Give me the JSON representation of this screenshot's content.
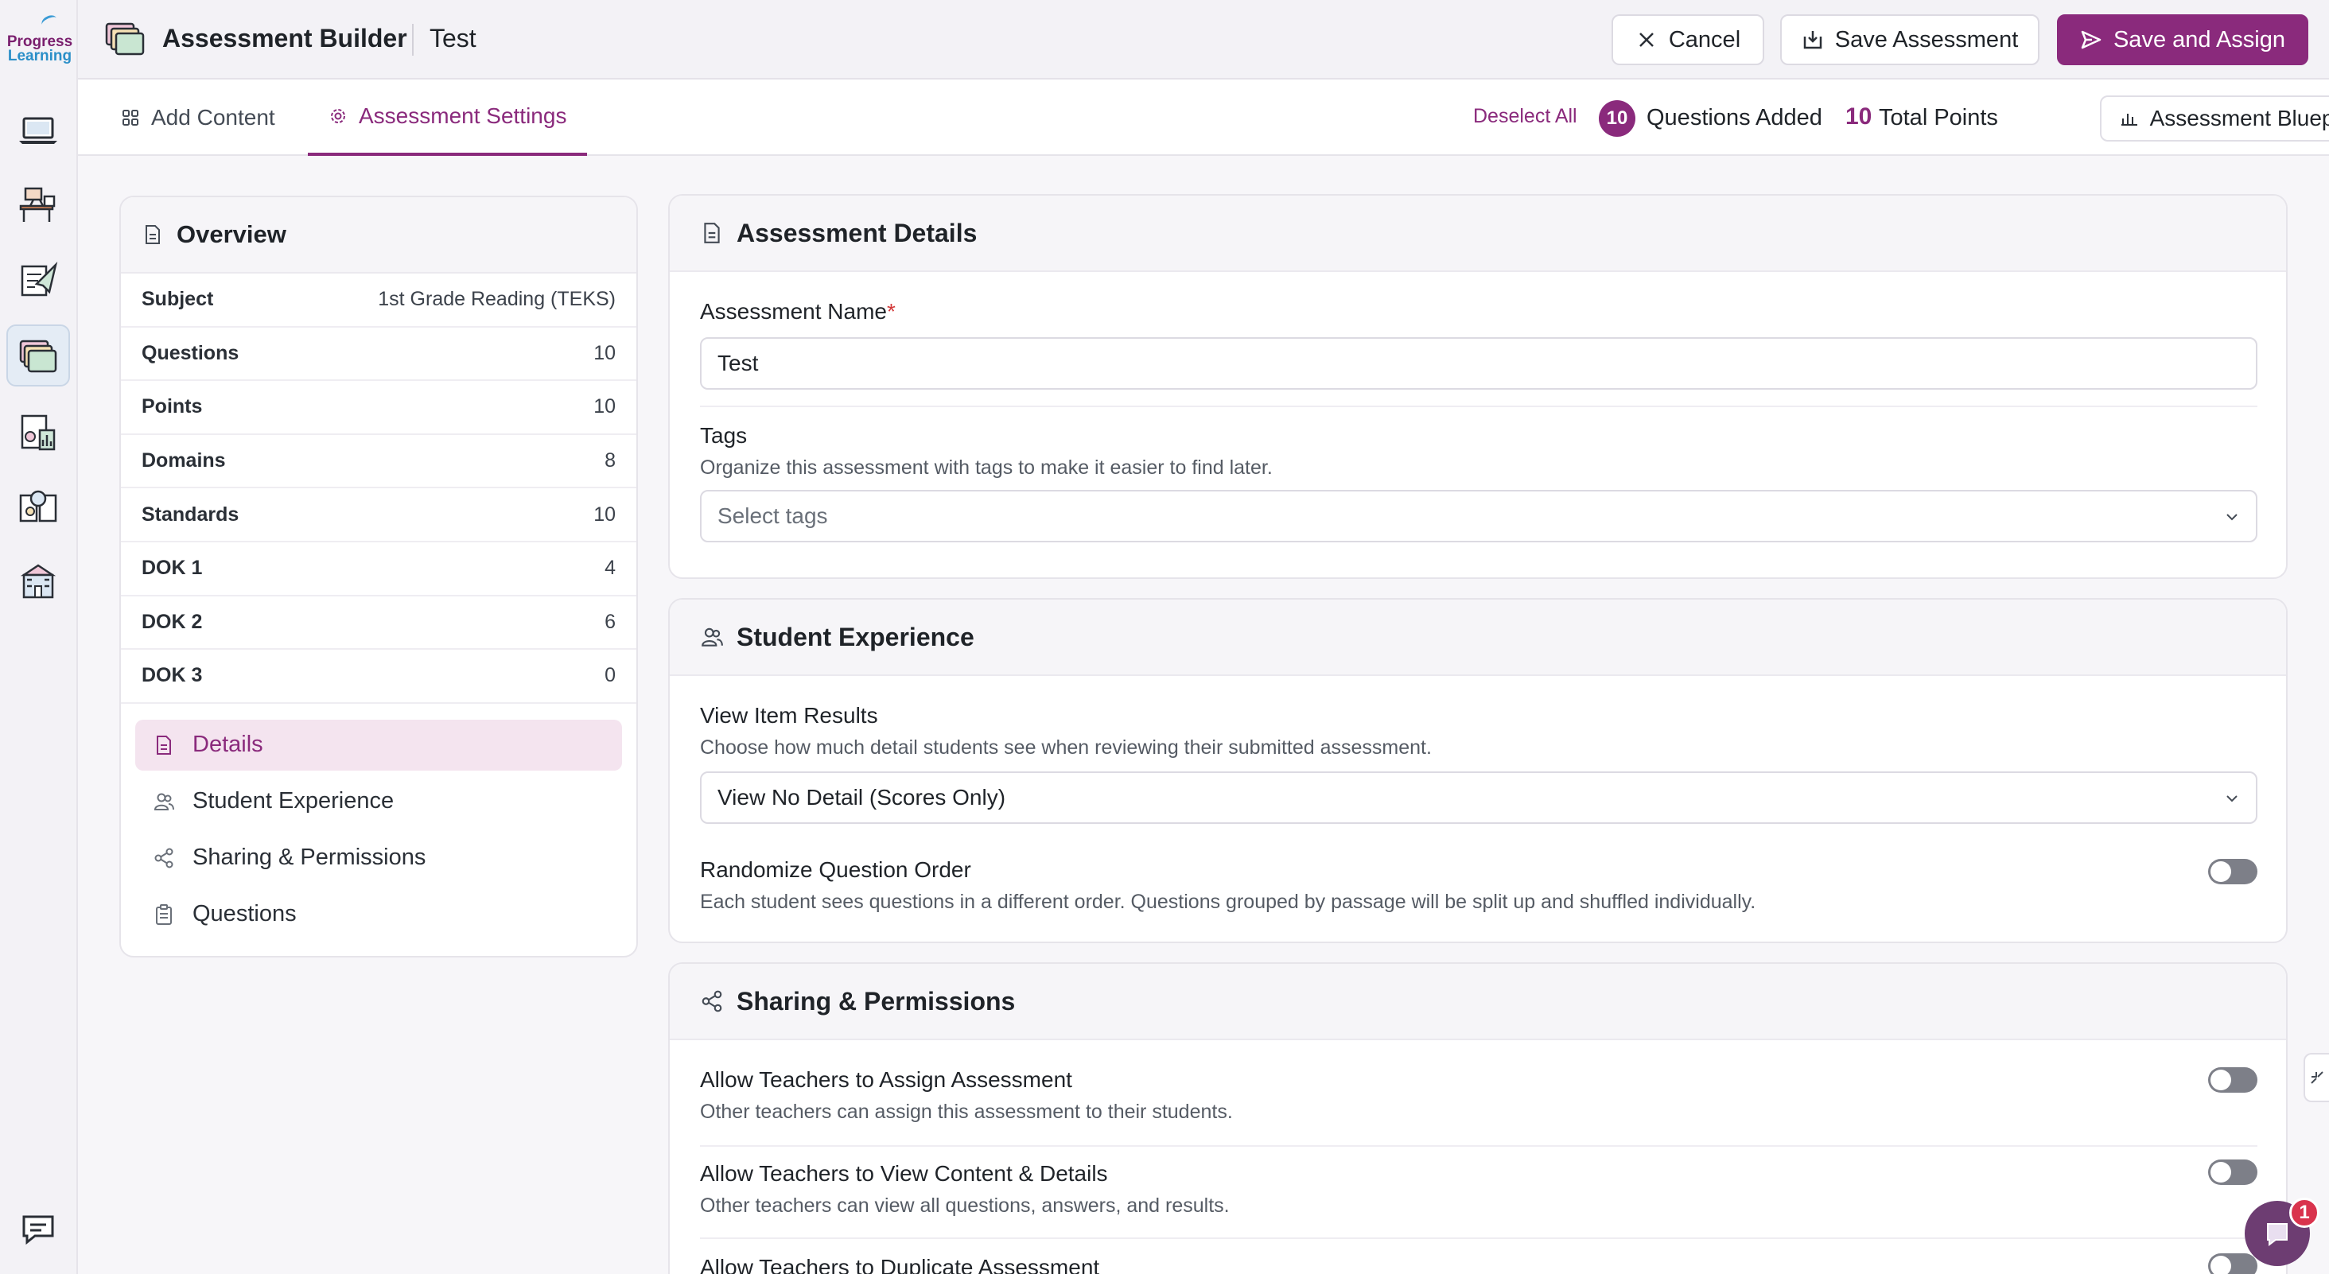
{
  "logo": {
    "line1": "Progress",
    "line2": "Learning"
  },
  "header": {
    "app_title": "Assessment Builder",
    "doc_title": "Test",
    "cancel_label": "Cancel",
    "save_label": "Save Assessment",
    "save_assign_label": "Save and Assign"
  },
  "tabs": [
    {
      "label": "Add Content",
      "icon": "grid-icon"
    },
    {
      "label": "Assessment Settings",
      "icon": "gear-icon",
      "active": true
    }
  ],
  "toolbar": {
    "deselect_label": "Deselect All",
    "questions_count": "10",
    "questions_label": "Questions Added",
    "points_count": "10",
    "points_label": "Total Points",
    "blueprint_label": "Assessment Blueprint"
  },
  "overview": {
    "title": "Overview",
    "rows": [
      {
        "key": "Subject",
        "value": "1st Grade Reading (TEKS)"
      },
      {
        "key": "Questions",
        "value": "10"
      },
      {
        "key": "Points",
        "value": "10"
      },
      {
        "key": "Domains",
        "value": "8"
      },
      {
        "key": "Standards",
        "value": "10"
      },
      {
        "key": "DOK 1",
        "value": "4"
      },
      {
        "key": "DOK 2",
        "value": "6"
      },
      {
        "key": "DOK 3",
        "value": "0"
      }
    ],
    "nav": [
      {
        "label": "Details",
        "icon": "document-icon",
        "active": true
      },
      {
        "label": "Student Experience",
        "icon": "users-icon"
      },
      {
        "label": "Sharing & Permissions",
        "icon": "share-icon"
      },
      {
        "label": "Questions",
        "icon": "clipboard-icon"
      }
    ]
  },
  "details": {
    "title": "Assessment Details",
    "name_label": "Assessment Name",
    "name_required": "*",
    "name_value": "Test",
    "tags_label": "Tags",
    "tags_help": "Organize this assessment with tags to make it easier to find later.",
    "tags_placeholder": "Select tags"
  },
  "student_experience": {
    "title": "Student Experience",
    "view_label": "View Item Results",
    "view_help": "Choose how much detail students see when reviewing their submitted assessment.",
    "view_value": "View No Detail (Scores Only)",
    "randomize_label": "Randomize Question Order",
    "randomize_help": "Each student sees questions in a different order. Questions grouped by passage will be split up and shuffled individually.",
    "randomize_on": false
  },
  "sharing": {
    "title": "Sharing & Permissions",
    "items": [
      {
        "label": "Allow Teachers to Assign Assessment",
        "help": "Other teachers can assign this assessment to their students.",
        "on": false
      },
      {
        "label": "Allow Teachers to View Content & Details",
        "help": "Other teachers can view all questions, answers, and results.",
        "on": false
      },
      {
        "label": "Allow Teachers to Duplicate Assessment",
        "help": "",
        "on": false
      }
    ]
  },
  "chat": {
    "badge": "1"
  },
  "colors": {
    "brand": "#8a2a7c",
    "badge": "#d9334d",
    "toggle_off": "#7d7f88"
  }
}
